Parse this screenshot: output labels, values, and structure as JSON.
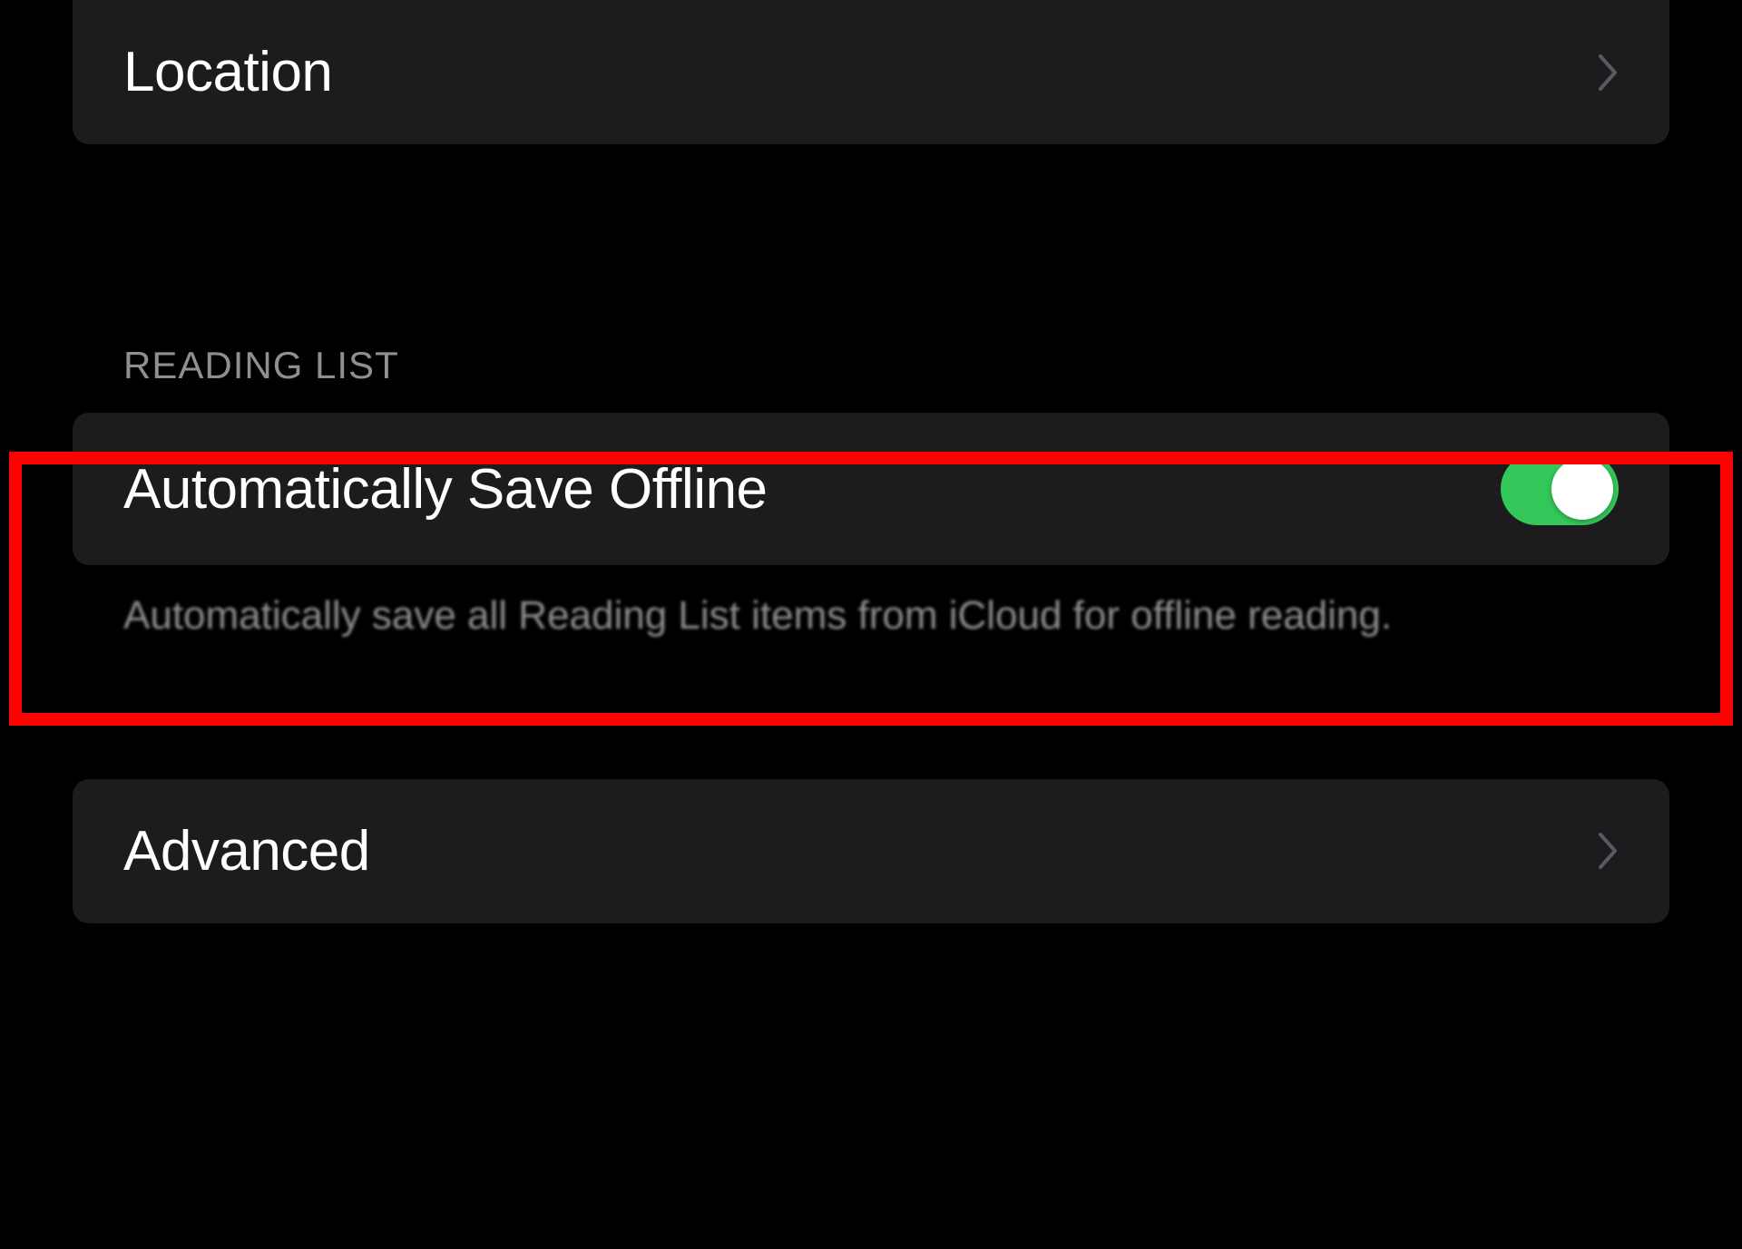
{
  "cells": {
    "location": {
      "label": "Location"
    },
    "auto_save_offline": {
      "label": "Automatically Save Offline",
      "toggle_on": true
    },
    "advanced": {
      "label": "Advanced"
    }
  },
  "sections": {
    "reading_list": {
      "header": "READING LIST",
      "footer": "Automatically save all Reading List items from iCloud for offline reading."
    }
  }
}
